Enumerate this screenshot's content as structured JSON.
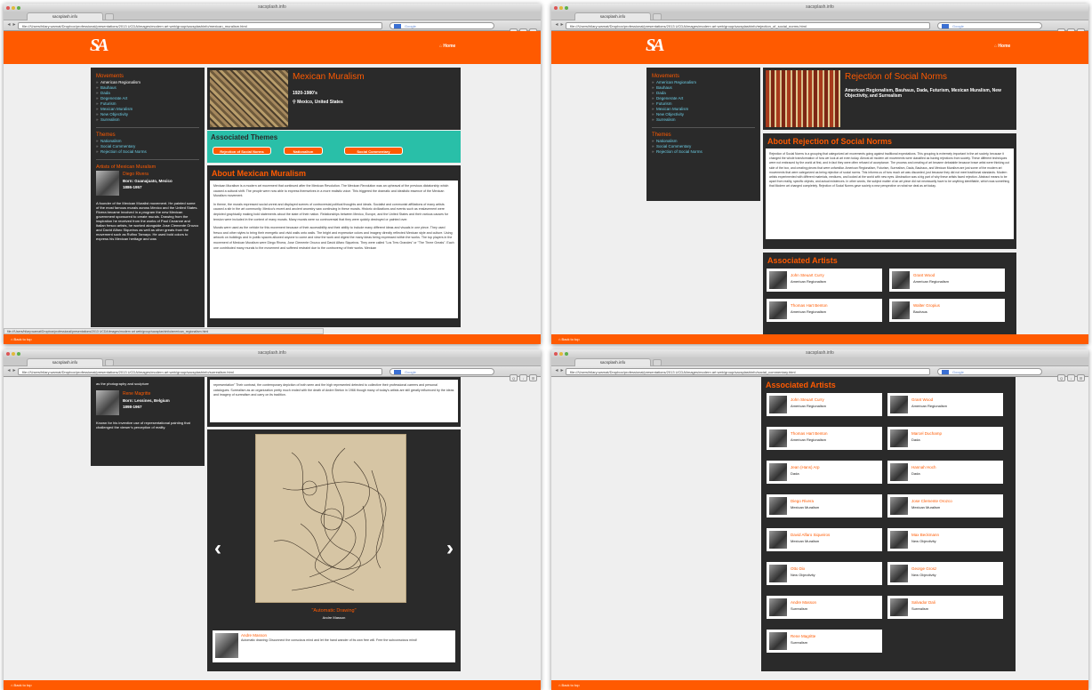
{
  "window_title": "sacsplash.info",
  "tab_label": "sacsplash.info",
  "google_placeholder": "Google",
  "logo": "SA",
  "home_label": "Home",
  "back_label": "Back to top",
  "status_url": "file:///Users/hilary.warnat/Dropbox/professional/presentations/2013 UCDA/images/modern art web/group/sacsplashinfo/american_regionalism.html",
  "sidebar": {
    "movements_heading": "Movements",
    "movements": [
      "American Regionalism",
      "Bauhaus",
      "Dada",
      "Degenerate Art",
      "Futurism",
      "Mexican Muralism",
      "New Objectivity",
      "Surrealism"
    ],
    "themes_heading": "Themes",
    "themes": [
      "Nationalism",
      "Social Commentary",
      "Rejection of Social Norms"
    ],
    "artists_heading": "Artists of Mexican Muralism"
  },
  "w1": {
    "url": "file:///Users/hilary.warnat/Dropbox/professional/presentations/2013 UCDA/images/modern art web/group/sacsplashinfo/mexican_muralism.html",
    "title": "Mexican Muralism",
    "years": "1920-1980's",
    "place": "Mexico, United States",
    "themes_heading": "Associated Themes",
    "theme_buttons": [
      "Rejection of Social Norms",
      "Nationalism",
      "Social Commentary"
    ],
    "about_heading": "About Mexican Muralism",
    "about_paragraphs": [
      "Mexican Muralism is a modern art movement that continued after the Mexican Revolution. The Mexican Revolution was an upheaval of the previous dictatorship which caused a cultural shift. The people were now able to express themselves in a more realistic voice. This triggered the dramatic and idealistic essence of the Mexican Muralism movement.",
      "In theme, the murals expressed social unrest and displayed scenes of controversial political thoughts and ideals. Socialist and communist affiliations of many artists caused a stir in the art community. Mexico's recent and ancient ancestry saw continuing in these murals. Historic civilizations and events such as enslavement were depicted graphically making bold statements about the state of their nation. Relationships between Mexico, Europe, and the United States and their various causes for tension were included in the context of many murals. Many murals were so controversial that they were quickly destroyed or painted over.",
      "Murals were used as the vehicle for this movement because of their accessibility and their ability to include many different ideas and visuals in one piece. They used fresco and other styles to bring their energetic and vivid walls onto walls. The bright and expressive colors and imagery directly reflected Mexican style and culture. Using artwork on buildings and in public spaces allowed anyone to come and view the work and digest the many ideas being expressed within the works. The top players in the movement of Mexican Muralism were Diego Rivera, Jose Clemente Orozco and David Alfaro Siqueiros. They were called \"Los Tres Grandes\" or \"The Three Greats\". Each one contributed many murals to the movement and suffered restraint due to the controversy of their works. Mexican"
    ],
    "artist_name": "Diego Rivera",
    "artist_born": "Born: Guanajuato, Mexico",
    "artist_years": "1886-1957",
    "artist_bio": "A founder of the Mexican Muralist movement. He painted some of the most famous murals across Mexico and the United States. Rivera became involved in a program the new Mexican government sponsored to create murals. Drawing from the inspiration he received from the works of Paul Cezanne and Italian fresco artists, he worked alongside Jose Clemente Orozco and David Alfaro Siqueiros as well as other greats from the movement such as Rufino Tamayo. He used bold colors to express his Mexican heritage and was"
  },
  "w2": {
    "url": "file:///Users/hilary.warnat/Dropbox/professional/presentations/2013 UCDA/images/modern art web/group/sacsplashinfo/rejection_of_social_norms.html",
    "title": "Rejection of Social Norms",
    "movements_line": "American Regionalism, Bauhaus, Dada, Futurism, Mexican Muralism, New Objectivity, and Surrealism",
    "about_heading": "About Rejection of Social Norms",
    "about_text": "Rejection of Social Norms is a grouping that categorized art movements going against traditional expectations. This grouping is extremely important in the art society, because it changed the whole transformation of how we look at art even today. Almost all modern art movements were classified as having rejections from society. These different techniques were not embraced by the world at first, and in fact they were often refused of acceptance. The process and creating of art became debatable because brave artist were thinking out side of the box, and creating pieces that were unfamiliar. American Regionalism, Futurism, Surrealism, Dada, Bauhaus, and Mexican Muralism are just some of the modern art movements that were categorized as being rejection of social norms. This informs us of how much art was discarded, just because they did not meet traditional standards. Modern artists experimented with different materials, mediums, and looked at the world with new eyes. Abstraction was a big part of why these artists faced rejection. Abstract means to be apart from reality, specific objects, and actual existences. In other words, the subject matter of an art piece did not necessarily have to be anything identifiable, which was something that Modern art changed completely. Rejection of Social Norms gave society a new perspective on what we deal as art today.",
    "artists_heading": "Associated Artists",
    "artists": [
      {
        "name": "John Steuart Curry",
        "movement": "American Regionalism"
      },
      {
        "name": "Grant Wood",
        "movement": "American Regionalism"
      },
      {
        "name": "Thomas Hart Benton",
        "movement": "American Regionalism"
      },
      {
        "name": "Walter Gropius",
        "movement": "Bauhaus"
      }
    ]
  },
  "w3": {
    "url": "file:///Users/hilary.warnat/Dropbox/professional/presentations/2013 UCDA/images/modern art web/group/sacsplashinfo/surrealism.html",
    "side_top": "as the photography and sculpture",
    "artist_name": "Rene Magritte",
    "artist_born": "Born: Lessines, Belgium",
    "artist_years": "1898-1967",
    "artist_bio": "Known for his inventive use of representational painting that challenged the viewer's perception of reality.",
    "top_text": "representation\" Their contrast, the contemporary depiction of both seen and the high represented detected to collective their professional careers and personal catalogues. Surrealism as an organization pretty much ended with the death of Andre Breton in 1966 though many of today's artists are still greatly influenced by the ideas and imagery of surrealism and carry on its tradition.",
    "caption": "\"Automatic Drawing\"",
    "caption_artist": "Andre Masson",
    "prev": "‹",
    "next": "›",
    "note_name": "Andre Masson",
    "note_text": "Automatic drawing: Disconnect the conscious mind and let the hand wander of its own free will. Free the subconscious mind!"
  },
  "w4": {
    "url": "file:///Users/hilary.warnat/Dropbox/professional/presentations/2013 UCDA/images/modern art web/group/sacsplashinfo/social_commentary.html",
    "heading": "Associated Artists",
    "artists": [
      {
        "name": "John Steuart Curry",
        "movement": "American Regionalism"
      },
      {
        "name": "Grant Wood",
        "movement": "American Regionalism"
      },
      {
        "name": "Thomas Hart Benton",
        "movement": "American Regionalism"
      },
      {
        "name": "Marcel Duchamp",
        "movement": "Dada"
      },
      {
        "name": "Jean (Hans) Arp",
        "movement": "Dada"
      },
      {
        "name": "Hannah Hoch",
        "movement": "Dada"
      },
      {
        "name": "Diego Rivera",
        "movement": "Mexican Muralism"
      },
      {
        "name": "Jose Clemente Orozco",
        "movement": "Mexican Muralism"
      },
      {
        "name": "David Alfaro Siqueiros",
        "movement": "Mexican Muralism"
      },
      {
        "name": "Max Beckmann",
        "movement": "New Objectivity"
      },
      {
        "name": "Otto Dix",
        "movement": "New Objectivity"
      },
      {
        "name": "George Grosz",
        "movement": "New Objectivity"
      },
      {
        "name": "Andre Masson",
        "movement": "Surrealism"
      },
      {
        "name": "Salvador Dali",
        "movement": "Surrealism"
      },
      {
        "name": "Rene Magritte",
        "movement": "Surrealism"
      }
    ]
  },
  "colors": {
    "accent": "#ff5a00",
    "panel": "#2a2a2a",
    "teal": "#29bfa8",
    "link": "#6ccde5"
  }
}
